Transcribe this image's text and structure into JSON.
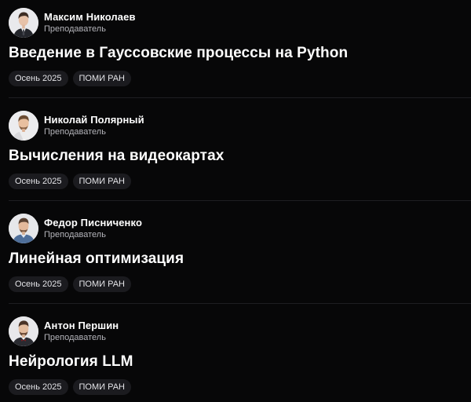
{
  "courses": [
    {
      "author": {
        "name": "Максим Николаев",
        "role": "Преподаватель",
        "avatar_icon": "person-avatar-icon"
      },
      "title": "Введение в Гауссовские процессы на Python",
      "tags": [
        "Осень 2025",
        "ПОМИ РАН"
      ]
    },
    {
      "author": {
        "name": "Николай Полярный",
        "role": "Преподаватель",
        "avatar_icon": "person-avatar-icon"
      },
      "title": "Вычисления на видеокартах",
      "tags": [
        "Осень 2025",
        "ПОМИ РАН"
      ]
    },
    {
      "author": {
        "name": "Федор Писниченко",
        "role": "Преподаватель",
        "avatar_icon": "person-avatar-icon"
      },
      "title": "Линейная оптимизация",
      "tags": [
        "Осень 2025",
        "ПОМИ РАН"
      ]
    },
    {
      "author": {
        "name": "Антон Першин",
        "role": "Преподаватель",
        "avatar_icon": "person-avatar-icon"
      },
      "title": "Нейрология LLM",
      "tags": [
        "Осень 2025",
        "ПОМИ РАН"
      ]
    }
  ],
  "colors": {
    "background": "#070708",
    "tag_background": "#1b1b1f",
    "divider": "#1e1e22",
    "text_primary": "#ffffff",
    "text_secondary": "#b4b4ba"
  }
}
